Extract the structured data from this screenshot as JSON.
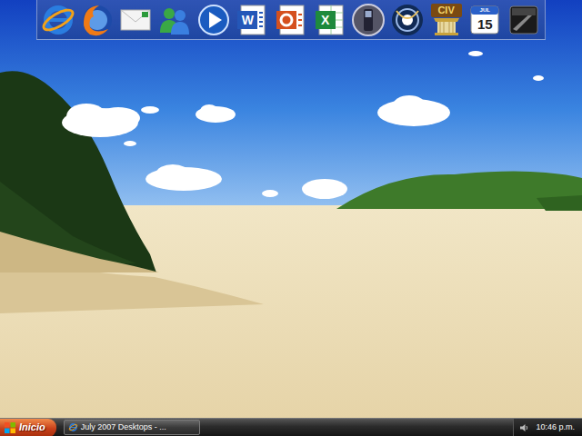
{
  "dock": {
    "items": [
      {
        "kind": "ie"
      },
      {
        "kind": "firefox"
      },
      {
        "kind": "mail"
      },
      {
        "kind": "messenger"
      },
      {
        "kind": "media"
      },
      {
        "kind": "word",
        "text": "W"
      },
      {
        "kind": "powerpoint"
      },
      {
        "kind": "excel",
        "text": "X"
      },
      {
        "kind": "phone"
      },
      {
        "kind": "orb"
      },
      {
        "kind": "civ",
        "text": "CIV"
      },
      {
        "kind": "calendar",
        "caption": "JUL",
        "text": "15"
      },
      {
        "kind": "dark"
      }
    ]
  },
  "taskbar": {
    "start": {
      "label": "Inicio"
    },
    "tasks": [
      {
        "label": "July 2007 Desktops - ...",
        "selected": false
      }
    ],
    "clock": "10:46 p.m."
  }
}
